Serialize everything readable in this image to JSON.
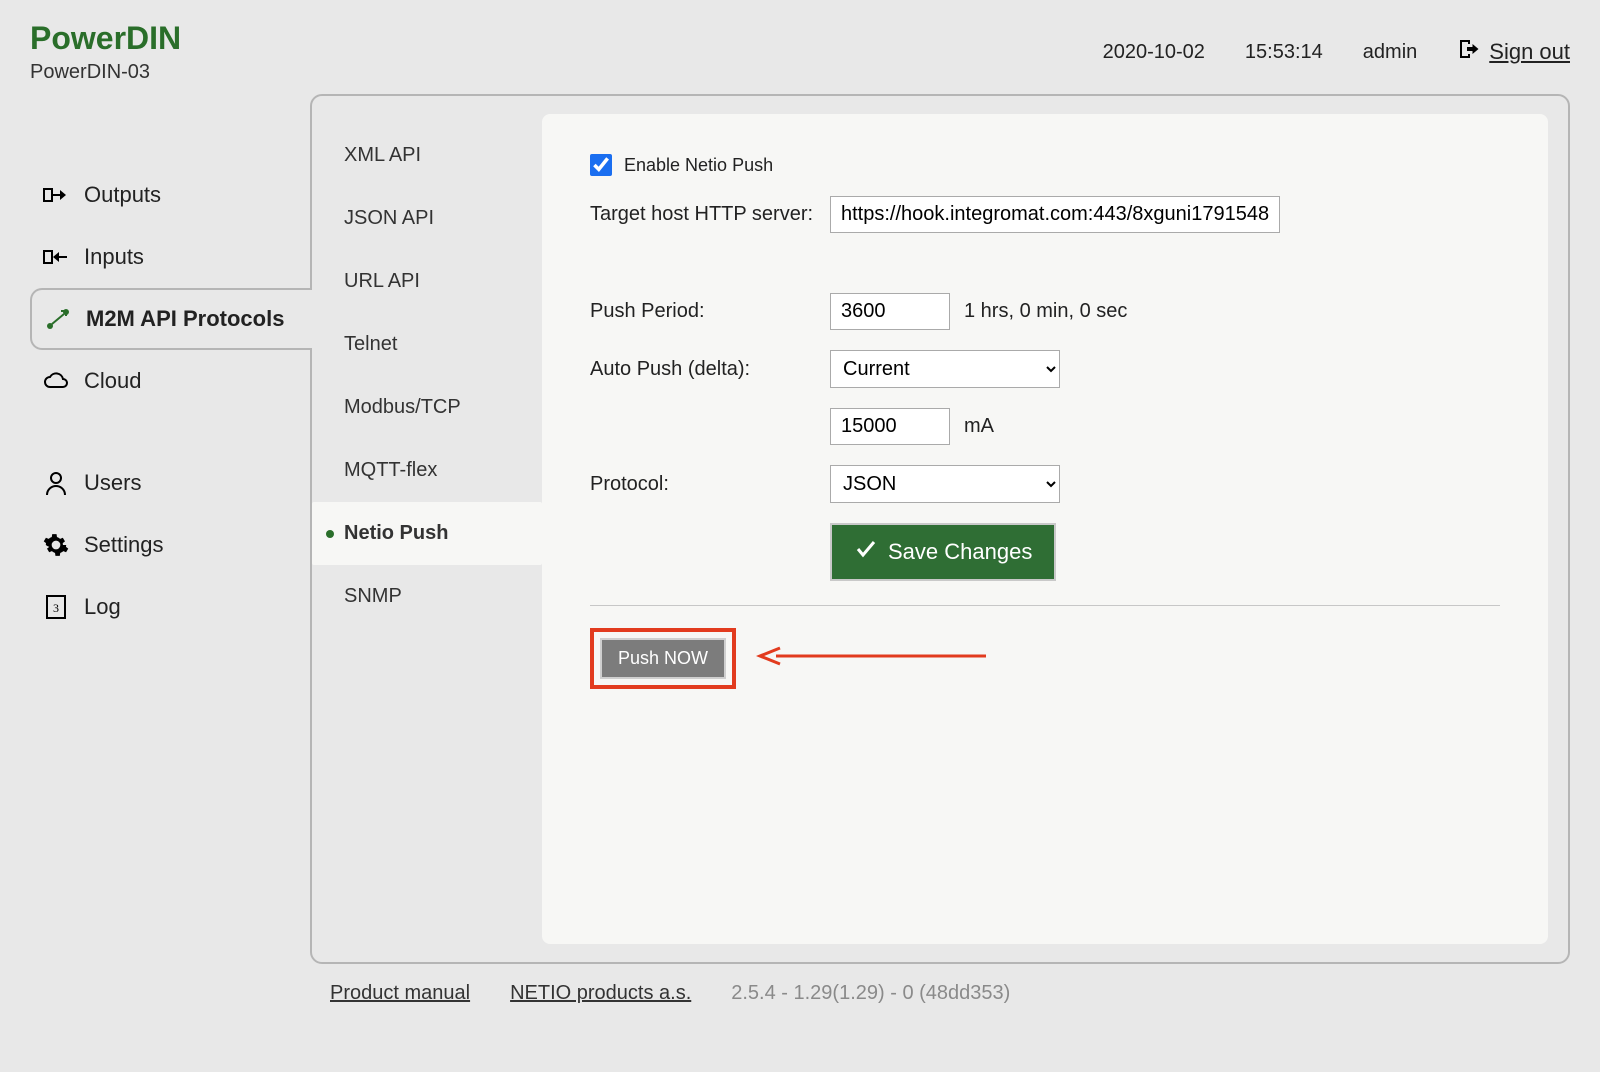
{
  "header": {
    "brand": "PowerDIN",
    "device_name": "PowerDIN-03",
    "date": "2020-10-02",
    "time": "15:53:14",
    "user": "admin",
    "signout_label": "Sign out"
  },
  "sidebar": {
    "items": [
      {
        "id": "outputs",
        "label": "Outputs"
      },
      {
        "id": "inputs",
        "label": "Inputs"
      },
      {
        "id": "m2m",
        "label": "M2M API Protocols",
        "active": true
      },
      {
        "id": "cloud",
        "label": "Cloud"
      },
      {
        "id": "users",
        "label": "Users"
      },
      {
        "id": "settings",
        "label": "Settings"
      },
      {
        "id": "log",
        "label": "Log"
      }
    ]
  },
  "subnav": {
    "items": [
      {
        "label": "XML API"
      },
      {
        "label": "JSON API"
      },
      {
        "label": "URL API"
      },
      {
        "label": "Telnet"
      },
      {
        "label": "Modbus/TCP"
      },
      {
        "label": "MQTT-flex"
      },
      {
        "label": "Netio Push",
        "active": true
      },
      {
        "label": "SNMP"
      }
    ]
  },
  "form": {
    "enable_label": "Enable Netio Push",
    "enable_checked": true,
    "target_label": "Target host HTTP server:",
    "target_value": "https://hook.integromat.com:443/8xguni1791548",
    "period_label": "Push Period:",
    "period_value": "3600",
    "period_hint": "1 hrs, 0 min, 0 sec",
    "delta_label": "Auto Push (delta):",
    "delta_selected": "Current",
    "delta_value": "15000",
    "delta_unit": "mA",
    "protocol_label": "Protocol:",
    "protocol_selected": "JSON",
    "save_label": "Save Changes",
    "push_now_label": "Push NOW"
  },
  "footer": {
    "manual": "Product manual",
    "company": "NETIO products a.s.",
    "version": "2.5.4 - 1.29(1.29) - 0 (48dd353)"
  }
}
